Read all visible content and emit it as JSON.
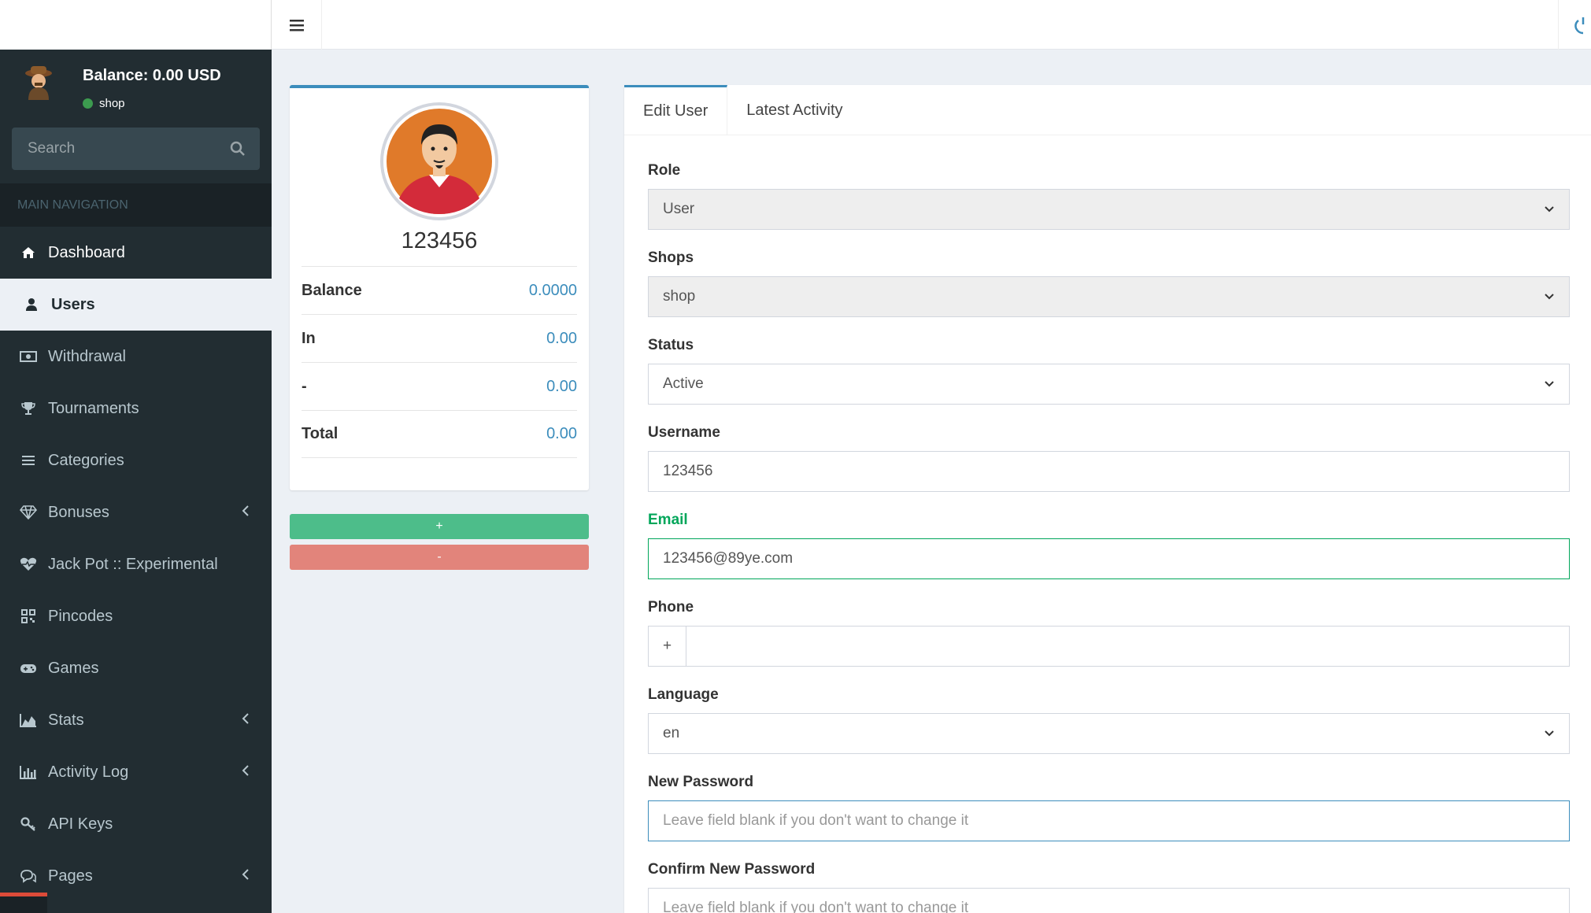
{
  "sidebar": {
    "balance": "Balance: 0.00 USD",
    "status": "shop",
    "search_placeholder": "Search",
    "nav_header": "MAIN NAVIGATION",
    "items": [
      {
        "label": "Dashboard",
        "icon": "home-icon"
      },
      {
        "label": "Users",
        "icon": "user-icon"
      },
      {
        "label": "Withdrawal",
        "icon": "money-icon"
      },
      {
        "label": "Tournaments",
        "icon": "trophy-icon"
      },
      {
        "label": "Categories",
        "icon": "list-icon"
      },
      {
        "label": "Bonuses",
        "icon": "diamond-icon"
      },
      {
        "label": "Jack Pot :: Experimental",
        "icon": "heartbeat-icon"
      },
      {
        "label": "Pincodes",
        "icon": "qrcode-icon"
      },
      {
        "label": "Games",
        "icon": "gamepad-icon"
      },
      {
        "label": "Stats",
        "icon": "area-chart-icon"
      },
      {
        "label": "Activity Log",
        "icon": "bar-chart-icon"
      },
      {
        "label": "API Keys",
        "icon": "key-icon"
      },
      {
        "label": "Pages",
        "icon": "comments-icon"
      }
    ]
  },
  "profile": {
    "name": "123456",
    "stats": [
      {
        "label": "Balance",
        "value": "0.0000"
      },
      {
        "label": "In",
        "value": "0.00"
      },
      {
        "label": "-",
        "value": "0.00"
      },
      {
        "label": "Total",
        "value": "0.00"
      }
    ],
    "plus_label": "+",
    "minus_label": "-"
  },
  "tabs": {
    "edit_user": "Edit User",
    "latest_activity": "Latest Activity"
  },
  "form": {
    "role_label": "Role",
    "role_value": "User",
    "shops_label": "Shops",
    "shops_value": "shop",
    "status_label": "Status",
    "status_value": "Active",
    "username_label": "Username",
    "username_value": "123456",
    "email_label": "Email",
    "email_value": "123456@89ye.com",
    "phone_label": "Phone",
    "phone_prefix": "+",
    "phone_value": "",
    "language_label": "Language",
    "language_value": "en",
    "new_password_label": "New Password",
    "new_password_placeholder": "Leave field blank if you don't want to change it",
    "confirm_password_label": "Confirm New Password",
    "confirm_password_placeholder": "Leave field blank if you don't want to change it"
  },
  "colors": {
    "sidebar_bg": "#222d32",
    "accent": "#3c8dbc",
    "success": "#00a65a",
    "plus_button": "#4dbd8a",
    "minus_button": "#e2847b"
  }
}
